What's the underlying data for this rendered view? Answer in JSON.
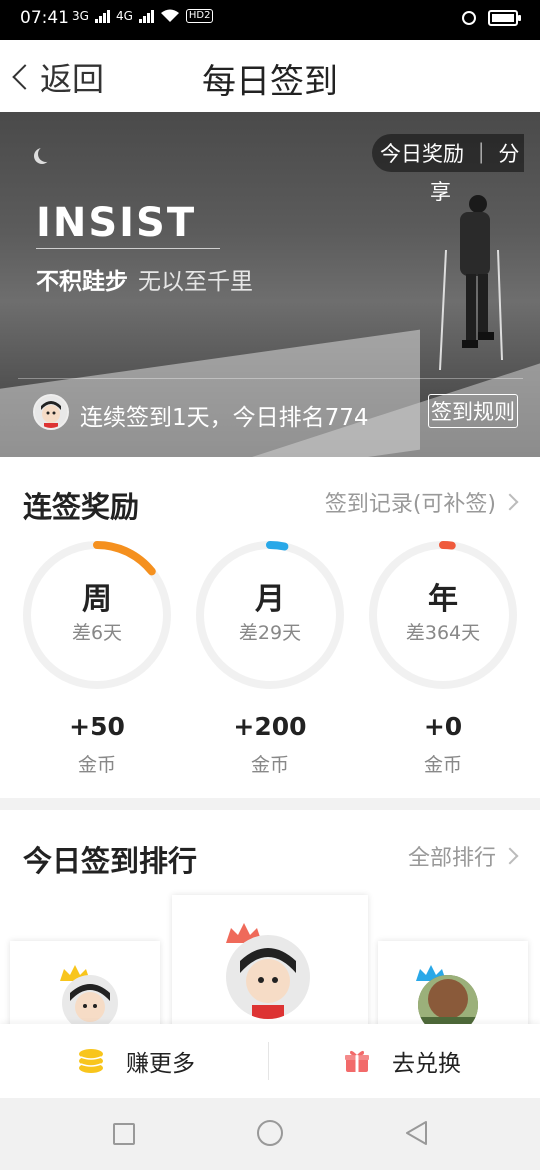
{
  "status_bar": {
    "time": "07:41",
    "net1": "3G",
    "net2": "4G",
    "hd": "HD2"
  },
  "nav": {
    "back_label": "返回",
    "title": "每日签到"
  },
  "banner": {
    "reward_tag": "今日奖励 ｜ 分",
    "reward_tag_wrap": "享",
    "headline": "INSIST",
    "motto_bold": "不积跬步",
    "motto_light": "无以至千里",
    "streak_text": "连续签到1天，今日排名774",
    "rules_button": "签到规则"
  },
  "rewards": {
    "title": "连签奖励",
    "link": "签到记录(可补签)",
    "items": [
      {
        "label": "周",
        "remaining": "差6天",
        "amount": "+50",
        "unit": "金币",
        "progress": 0.143,
        "color": "#f5901e"
      },
      {
        "label": "月",
        "remaining": "差29天",
        "amount": "+200",
        "unit": "金币",
        "progress": 0.033,
        "color": "#29a8e8"
      },
      {
        "label": "年",
        "remaining": "差364天",
        "amount": "+0",
        "unit": "金币",
        "progress": 0.003,
        "color": "#ef5a3c"
      }
    ]
  },
  "ranking": {
    "title": "今日签到排行",
    "link": "全部排行"
  },
  "actions": {
    "earn": "赚更多",
    "exchange": "去兑换"
  },
  "colors": {
    "accent_orange": "#f5901e",
    "accent_blue": "#29a8e8",
    "accent_red": "#ef5a3c",
    "coin_yellow": "#f8c51c",
    "gift_red": "#f26a6a"
  }
}
